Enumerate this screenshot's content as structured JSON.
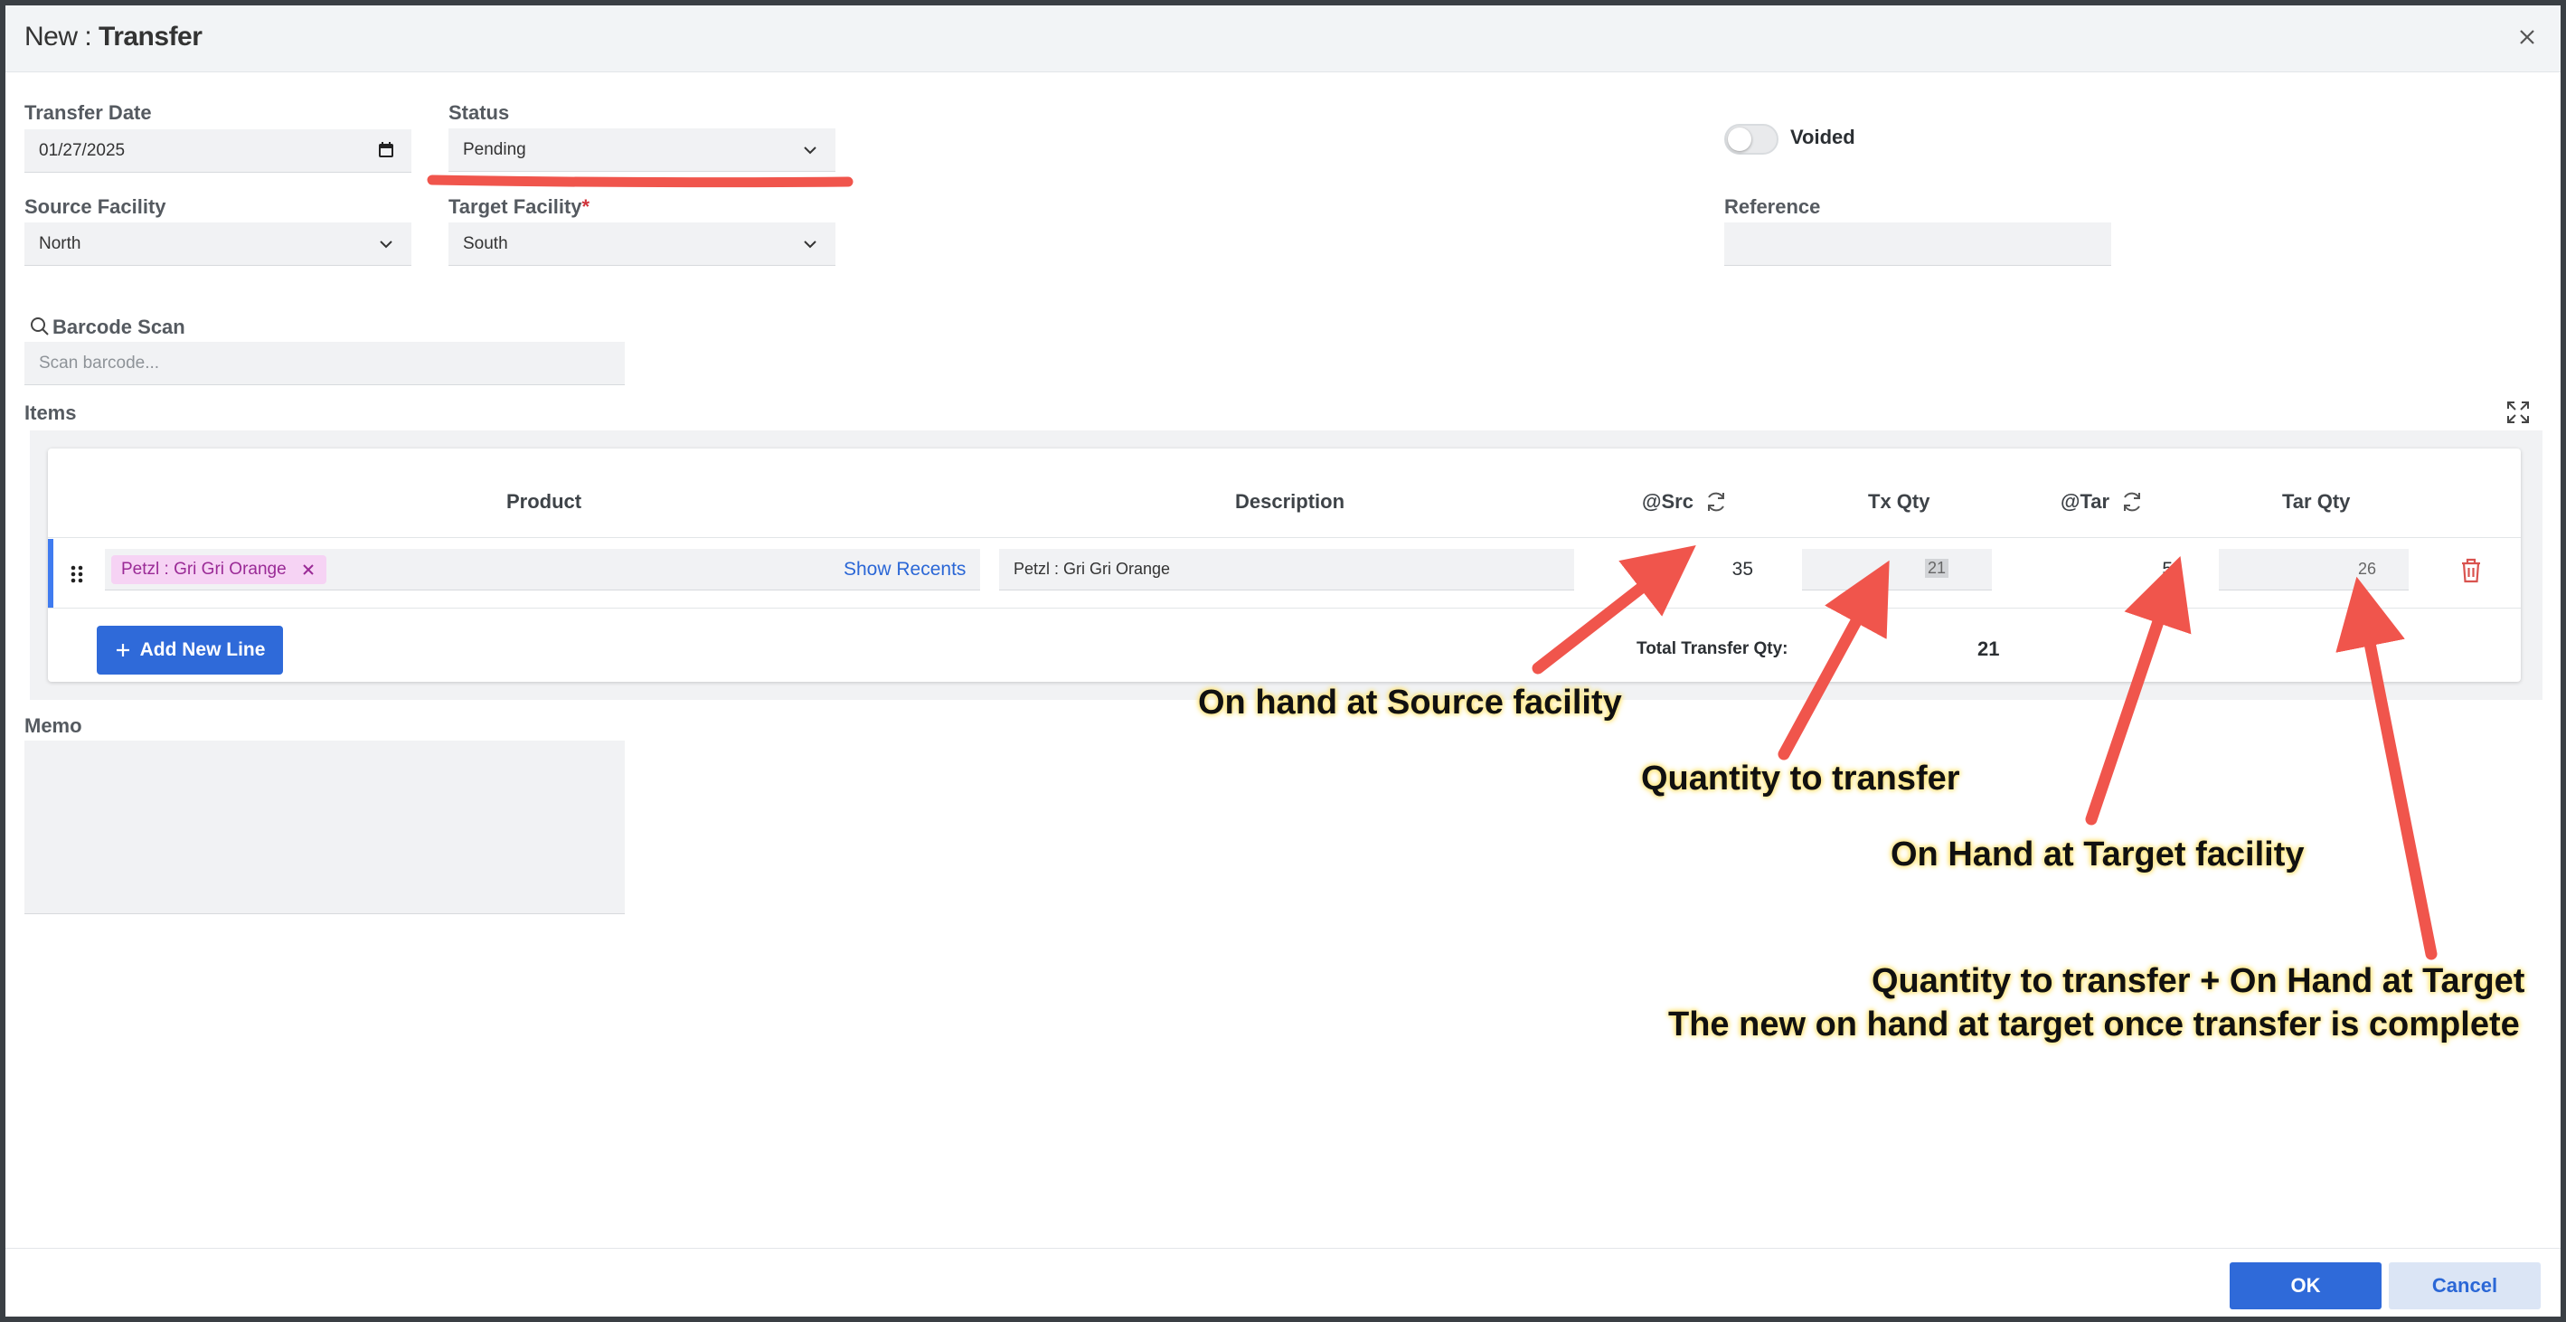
{
  "window": {
    "title_prefix": "New : ",
    "title_main": "Transfer"
  },
  "form": {
    "transfer_date_label": "Transfer Date",
    "transfer_date_value": "01/27/2025",
    "status_label": "Status",
    "status_value": "Pending",
    "voided_label": "Voided",
    "source_facility_label": "Source Facility",
    "source_facility_value": "North",
    "target_facility_label": "Target Facility",
    "target_facility_required": "*",
    "target_facility_value": "South",
    "reference_label": "Reference",
    "reference_value": "",
    "barcode_label": "Barcode Scan",
    "barcode_placeholder": "Scan barcode...",
    "items_label": "Items",
    "memo_label": "Memo"
  },
  "table": {
    "headers": [
      "Product",
      "Description",
      "@Src",
      "Tx Qty",
      "@Tar",
      "Tar Qty"
    ],
    "row": {
      "product_tag": "Petzl : Gri Gri Orange",
      "show_recents": "Show Recents",
      "description": "Petzl : Gri Gri Orange",
      "src": "35",
      "tx_qty": "21",
      "tar": "5",
      "tar_qty": "26"
    },
    "add_new_line": "Add New Line",
    "total_label": "Total Transfer Qty:",
    "total_value": "21"
  },
  "buttons": {
    "ok": "OK",
    "cancel": "Cancel"
  },
  "annotations": {
    "on_hand_source": "On hand at Source facility",
    "qty_to_transfer": "Quantity to transfer",
    "on_hand_target": "On Hand at Target facility",
    "sum_line1": "Quantity to transfer + On Hand at Target",
    "sum_line2": "The new on hand at target once transfer is complete"
  },
  "colors": {
    "primary": "#2f6ad9",
    "annotation_arrow": "#f0554c",
    "tag_bg": "#f6d3f4",
    "tag_text": "#9a2a96",
    "trash": "#d9534f"
  },
  "icons": [
    "close-icon",
    "calendar-icon",
    "chevron-down-icon",
    "search-icon",
    "expand-icon",
    "drag-handle-icon",
    "refresh-icon",
    "trash-icon",
    "plus-icon"
  ]
}
